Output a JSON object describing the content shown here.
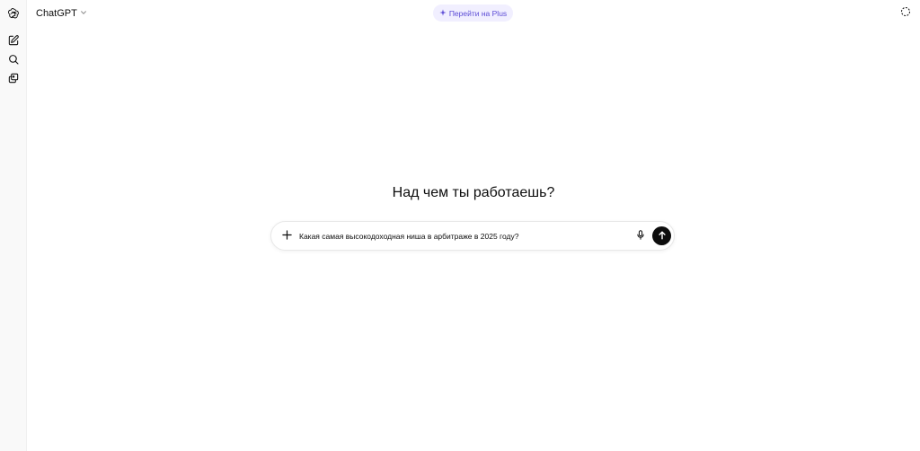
{
  "header": {
    "model_name": "ChatGPT",
    "upgrade_label": "Перейти на Plus"
  },
  "icons": {
    "logo": "openai-logo-icon",
    "new_chat": "new-chat-icon",
    "search": "search-icon",
    "library": "library-icon",
    "model_chevron": "chevron-down-icon",
    "upgrade": "sparkle-icon",
    "temporary_chat": "dashed-circle-icon",
    "attach": "plus-icon",
    "voice": "microphone-icon",
    "send": "arrow-up-icon"
  },
  "main": {
    "headline": "Над чем ты работаешь?"
  },
  "composer": {
    "value": "Какая самая высокодоходная ниша в арбитраже в 2025 году?"
  },
  "colors": {
    "accent_upgrade_bg": "#f1efff",
    "accent_upgrade_text": "#5b4bd6",
    "send_button": "#0d0d0d"
  }
}
